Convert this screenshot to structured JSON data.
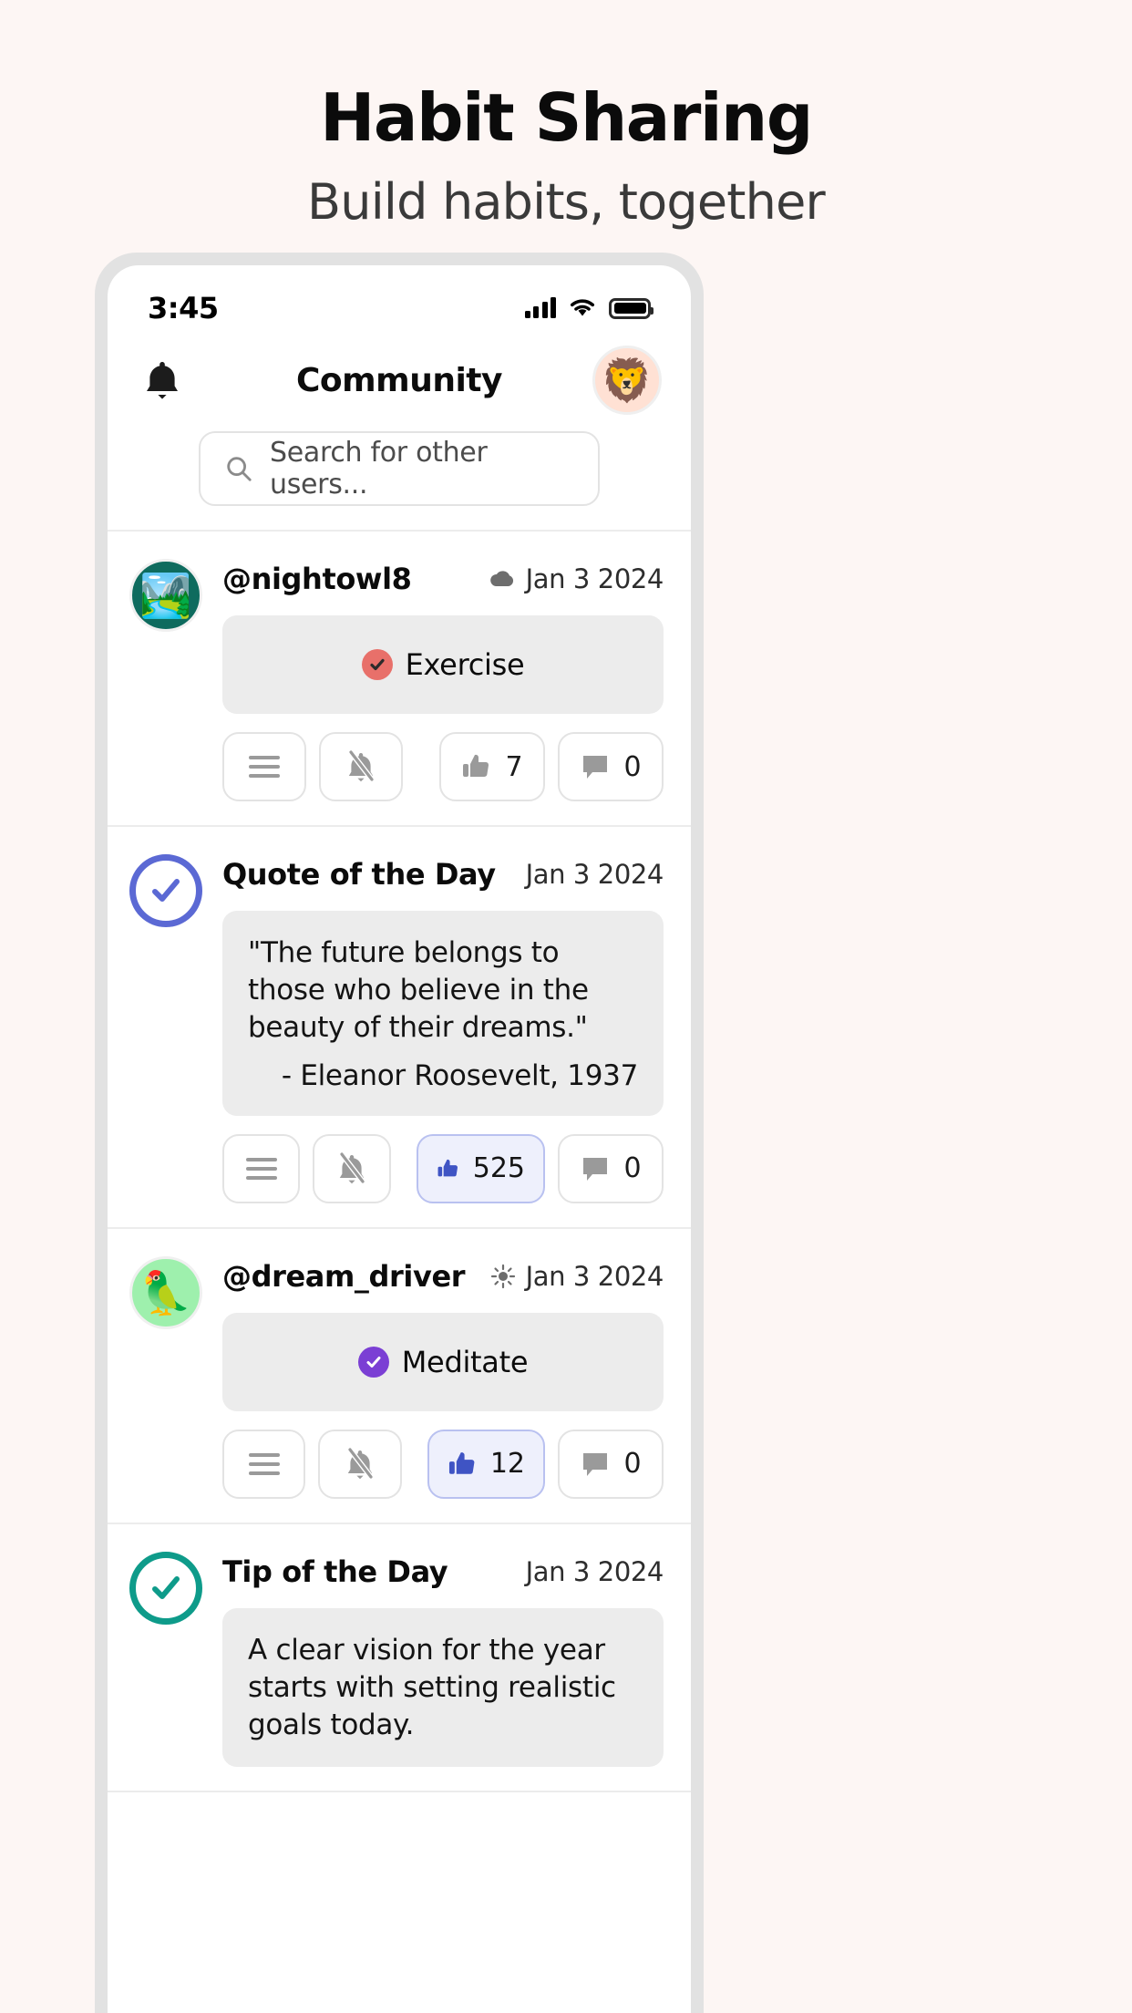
{
  "promo": {
    "title": "Habit Sharing",
    "subtitle": "Build habits, together"
  },
  "status_bar": {
    "time": "3:45",
    "icons": [
      "cellular-signal-icon",
      "wifi-icon",
      "battery-icon"
    ]
  },
  "app_header": {
    "bell_icon": "bell-icon",
    "title": "Community",
    "avatar_emoji": "🦁"
  },
  "search": {
    "placeholder": "Search for other users...",
    "value": "",
    "icon": "search-icon"
  },
  "colors": {
    "accent_blue": "#5b69d4",
    "accent_teal": "#0e9b8a",
    "habit_exercise": "#e8706a",
    "habit_meditate": "#7b3fd4",
    "page_bg": "#fdf6f4",
    "card_bg": "#ececec"
  },
  "action_labels": {
    "details": "details-button",
    "mute": "mute-button",
    "like": "like-button",
    "comment": "comment-button"
  },
  "posts": [
    {
      "id": "post-nightowl8",
      "type": "habit",
      "avatar_kind": "emoji",
      "avatar_emoji": "🏞️",
      "avatar_bg": "#0e6b5e",
      "username": "@nightowl8",
      "weather_icon": "cloud-icon",
      "date": "Jan 3 2024",
      "habit_label": "Exercise",
      "habit_color": "#e8706a",
      "like_count": "7",
      "comment_count": "0",
      "liked": false
    },
    {
      "id": "post-quote-of-the-day",
      "type": "quote",
      "avatar_kind": "check-ring",
      "avatar_color": "#5b69d4",
      "username": "Quote of the Day",
      "weather_icon": "",
      "date": "Jan 3 2024",
      "quote": "\"The future belongs to those who believe in the beauty of their dreams.\"",
      "author": "- Eleanor Roosevelt, 1937",
      "like_count": "525",
      "comment_count": "0",
      "liked": true
    },
    {
      "id": "post-dream_driver",
      "type": "habit",
      "avatar_kind": "emoji",
      "avatar_emoji": "🦜",
      "avatar_bg": "#9ef0ad",
      "username": "@dream_driver",
      "weather_icon": "sun-icon",
      "date": "Jan 3 2024",
      "habit_label": "Meditate",
      "habit_color": "#7b3fd4",
      "like_count": "12",
      "comment_count": "0",
      "liked": true
    },
    {
      "id": "post-tip-of-the-day",
      "type": "tip",
      "avatar_kind": "check-ring",
      "avatar_color": "#0e9b8a",
      "username": "Tip of the Day",
      "weather_icon": "",
      "date": "Jan 3 2024",
      "tip": "A clear vision for the year starts with setting realistic goals today."
    }
  ]
}
